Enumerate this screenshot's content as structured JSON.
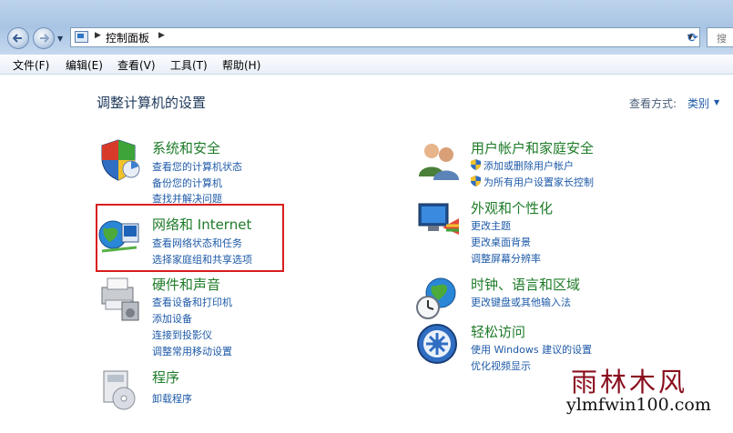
{
  "address": {
    "crumb": "控制面板",
    "search_placeholder": "搜"
  },
  "menu": [
    "文件(F)",
    "编辑(E)",
    "查看(V)",
    "工具(T)",
    "帮助(H)"
  ],
  "heading": "调整计算机的设置",
  "view_by": {
    "label": "查看方式:",
    "value": "类别"
  },
  "categories": {
    "system": {
      "title": "系统和安全",
      "links": [
        "查看您的计算机状态",
        "备份您的计算机",
        "查找并解决问题"
      ]
    },
    "network": {
      "title": "网络和 Internet",
      "links": [
        "查看网络状态和任务",
        "选择家庭组和共享选项"
      ]
    },
    "hardware": {
      "title": "硬件和声音",
      "links": [
        "查看设备和打印机",
        "添加设备",
        "连接到投影仪",
        "调整常用移动设置"
      ]
    },
    "programs": {
      "title": "程序",
      "links": [
        "卸载程序"
      ]
    },
    "users": {
      "title": "用户帐户和家庭安全",
      "links": [
        "添加或删除用户帐户",
        "为所有用户设置家长控制"
      ]
    },
    "appearance": {
      "title": "外观和个性化",
      "links": [
        "更改主题",
        "更改桌面背景",
        "调整屏幕分辨率"
      ]
    },
    "clock": {
      "title": "时钟、语言和区域",
      "links": [
        "更改键盘或其他输入法"
      ]
    },
    "ease": {
      "title": "轻松访问",
      "links": [
        "使用 Windows 建议的设置",
        "优化视频显示"
      ]
    }
  },
  "watermark": {
    "title": "雨林木风",
    "url": "ylmfwin100.com"
  },
  "colors": {
    "category_title": "#1e7b28",
    "link": "#1e5aa8",
    "highlight": "#d81e1e"
  }
}
